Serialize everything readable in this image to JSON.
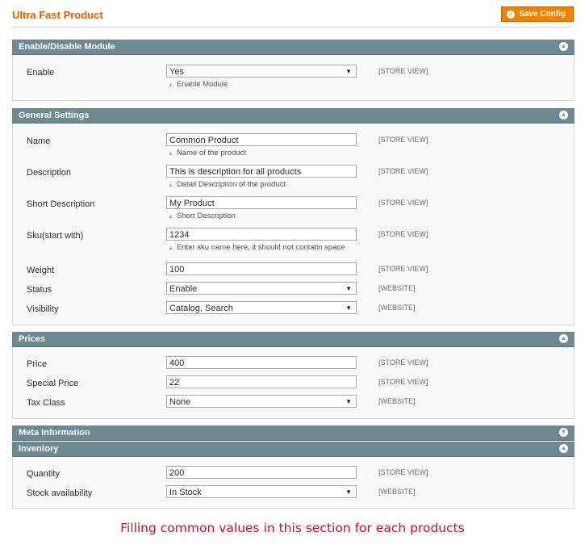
{
  "page": {
    "title": "Ultra Fast Product",
    "save_label": "Save Config",
    "caption": "Filling common values in this section for each products"
  },
  "sections": {
    "enable": {
      "title": "Enable/Disable Module",
      "fields": {
        "enable": {
          "label": "Enable",
          "value": "Yes",
          "note": "Enable Module",
          "scope": "[STORE VIEW]"
        }
      }
    },
    "general": {
      "title": "General Settings",
      "fields": {
        "name": {
          "label": "Name",
          "value": "Common Product",
          "note": "Name of the product",
          "scope": "[STORE VIEW]"
        },
        "description": {
          "label": "Description",
          "value": "This is description for all products",
          "note": "Detail Description of the product",
          "scope": "[STORE VIEW]"
        },
        "short_description": {
          "label": "Short Description",
          "value": "My Product",
          "note": "Short Description",
          "scope": "[STORE VIEW]"
        },
        "sku": {
          "label": "Sku(start with)",
          "value": "1234",
          "note": "Enter sku name here, it should not contatin space",
          "scope": "[STORE VIEW]"
        },
        "weight": {
          "label": "Weight",
          "value": "100",
          "scope": "[STORE VIEW]"
        },
        "status": {
          "label": "Status",
          "value": "Enable",
          "scope": "[WEBSITE]"
        },
        "visibility": {
          "label": "Visibility",
          "value": "Catalog, Search",
          "scope": "[WEBSITE]"
        }
      }
    },
    "prices": {
      "title": "Prices",
      "fields": {
        "price": {
          "label": "Price",
          "value": "400",
          "scope": "[STORE VIEW]"
        },
        "special_price": {
          "label": "Special Price",
          "value": "22",
          "scope": "[STORE VIEW]"
        },
        "tax_class": {
          "label": "Tax Class",
          "value": "None",
          "scope": "[WEBSITE]"
        }
      }
    },
    "meta": {
      "title": "Meta Information"
    },
    "inventory": {
      "title": "Inventory",
      "fields": {
        "quantity": {
          "label": "Quantity",
          "value": "200",
          "scope": "[STORE VIEW]"
        },
        "stock": {
          "label": "Stock availability",
          "value": "In Stock",
          "scope": "[WEBSITE]"
        }
      }
    }
  },
  "icons": {
    "collapse": "collapse-up-icon",
    "expand": "expand-down-icon",
    "save": "check-circle-icon",
    "dropdown": "dropdown-arrow-icon",
    "note": "note-triangle-icon"
  },
  "colors": {
    "title": "#eb5e00",
    "save_button": "#f18200",
    "section_header": "#6f8992",
    "caption": "#c8102e"
  }
}
